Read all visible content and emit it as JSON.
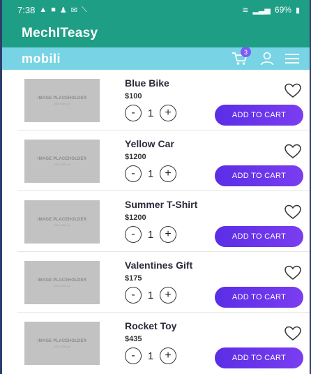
{
  "status_bar": {
    "time": "7:38",
    "battery": "69%"
  },
  "app_bar": {
    "title": "MechITeasy"
  },
  "nav_bar": {
    "brand": "mobili",
    "cart_count": "3"
  },
  "placeholder": {
    "title": "IMAGE PLACEHOLDER",
    "subtitle": "500 x 500 px"
  },
  "products": [
    {
      "name": "Blue Bike",
      "price": "$100",
      "qty": "1",
      "add_label": "ADD TO CART"
    },
    {
      "name": "Yellow Car",
      "price": "$1200",
      "qty": "1",
      "add_label": "ADD TO CART"
    },
    {
      "name": "Summer T-Shirt",
      "price": "$1200",
      "qty": "1",
      "add_label": "ADD TO CART"
    },
    {
      "name": "Valentines Gift",
      "price": "$175",
      "qty": "1",
      "add_label": "ADD TO CART"
    },
    {
      "name": "Rocket Toy",
      "price": "$435",
      "qty": "1",
      "add_label": "ADD TO CART"
    }
  ],
  "qty_controls": {
    "minus": "-",
    "plus": "+"
  },
  "colors": {
    "status_bar": "#1f9e86",
    "nav_bar": "#78d4e4",
    "button": "#6a35ec",
    "placeholder": "#c2c2c2"
  },
  "icons": [
    "signal-icon",
    "wifi-icon",
    "battery-icon",
    "cart-icon",
    "user-icon",
    "menu-icon",
    "heart-icon"
  ]
}
